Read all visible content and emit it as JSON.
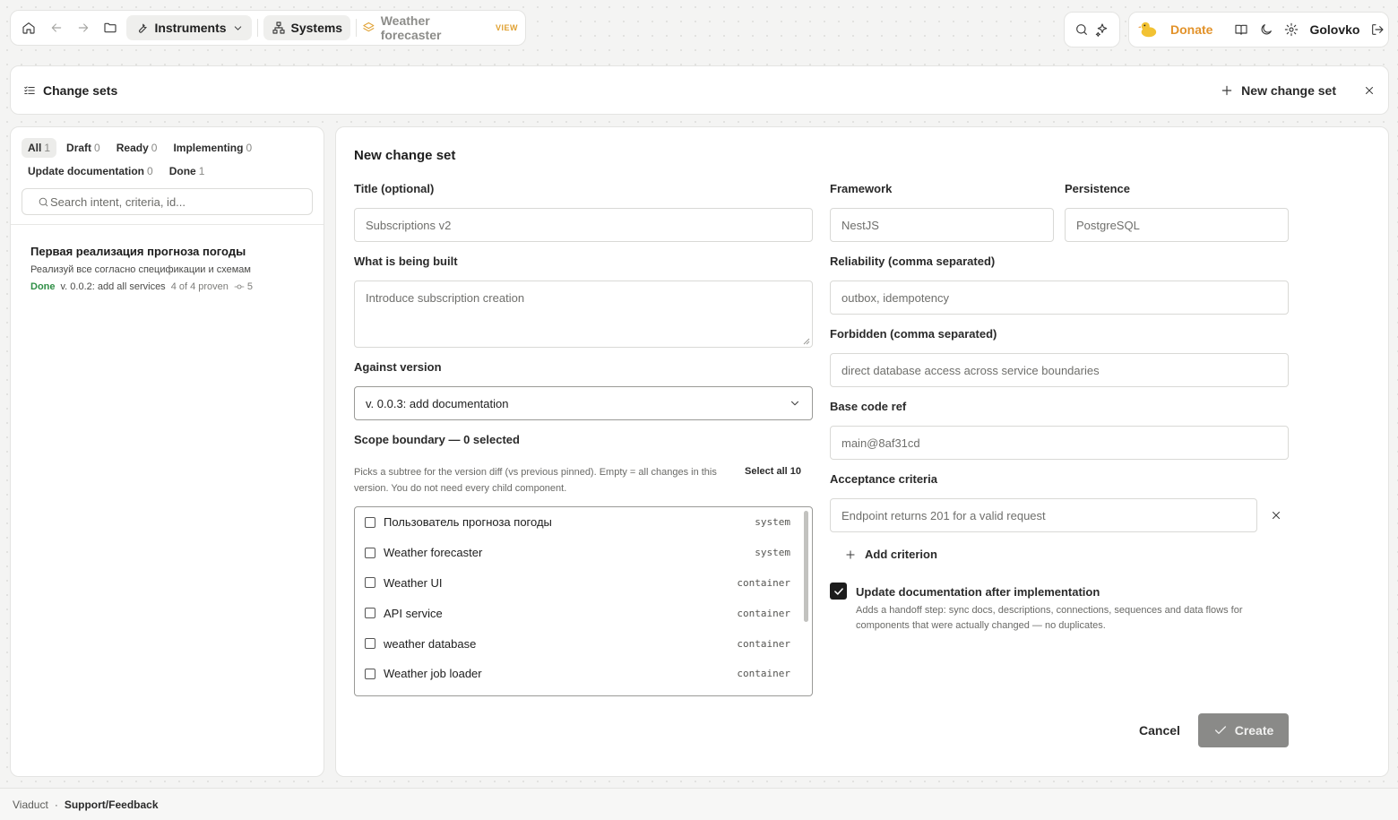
{
  "nav": {
    "instruments_label": "Instruments",
    "systems_label": "Systems",
    "breadcrumb_label": "Weather forecaster",
    "view_badge": "VIEW",
    "donate_label": "Donate",
    "user_name": "Golovko",
    "accent_color": "#e2922a"
  },
  "header": {
    "title": "Change sets",
    "new_button_label": "New change set"
  },
  "list": {
    "filters": [
      {
        "label": "All",
        "count": "1",
        "active": true
      },
      {
        "label": "Draft",
        "count": "0"
      },
      {
        "label": "Ready",
        "count": "0"
      },
      {
        "label": "Implementing",
        "count": "0"
      },
      {
        "label": "Update documentation",
        "count": "0"
      },
      {
        "label": "Done",
        "count": "1"
      }
    ],
    "search_placeholder": "Search intent, criteria, id...",
    "items": [
      {
        "title": "Первая реализация прогноза погоды",
        "description": "Реализуй все согласно спецификации и схемам",
        "status": "Done",
        "version": "v. 0.0.2: add all services",
        "proven": "4 of 4 proven",
        "commits": "5"
      }
    ]
  },
  "form": {
    "title": "New change set",
    "title_label": "Title (optional)",
    "title_placeholder": "Subscriptions v2",
    "built_label": "What is being built",
    "built_placeholder": "Introduce subscription creation",
    "version_label": "Against version",
    "version_value": "v. 0.0.3: add documentation",
    "scope_label": "Scope boundary — 0 selected",
    "scope_help": "Picks a subtree for the version diff (vs previous pinned). Empty = all changes in this version. You do not need every child component.",
    "select_all_label": "Select all 10",
    "scope_items": [
      {
        "name": "Пользователь прогноза погоды",
        "kind": "system"
      },
      {
        "name": "Weather forecaster",
        "kind": "system"
      },
      {
        "name": "Weather UI",
        "kind": "container"
      },
      {
        "name": "API service",
        "kind": "container"
      },
      {
        "name": "weather database",
        "kind": "container"
      },
      {
        "name": "Weather job loader",
        "kind": "container"
      }
    ],
    "framework_label": "Framework",
    "framework_placeholder": "NestJS",
    "persistence_label": "Persistence",
    "persistence_placeholder": "PostgreSQL",
    "reliability_label": "Reliability (comma separated)",
    "reliability_placeholder": "outbox, idempotency",
    "forbidden_label": "Forbidden (comma separated)",
    "forbidden_placeholder": "direct database access across service boundaries",
    "base_ref_label": "Base code ref",
    "base_ref_placeholder": "main@8af31cd",
    "acceptance_label": "Acceptance criteria",
    "acceptance_placeholder": "Endpoint returns 201 for a valid request",
    "add_criterion_label": "Add criterion",
    "update_docs_label": "Update documentation after implementation",
    "update_docs_help": "Adds a handoff step: sync docs, descriptions, connections, sequences and data flows for components that were actually changed — no duplicates.",
    "update_docs_checked": true,
    "cancel_label": "Cancel",
    "create_label": "Create"
  },
  "footer": {
    "brand": "Viaduct",
    "separator": "·",
    "link": "Support/Feedback"
  }
}
